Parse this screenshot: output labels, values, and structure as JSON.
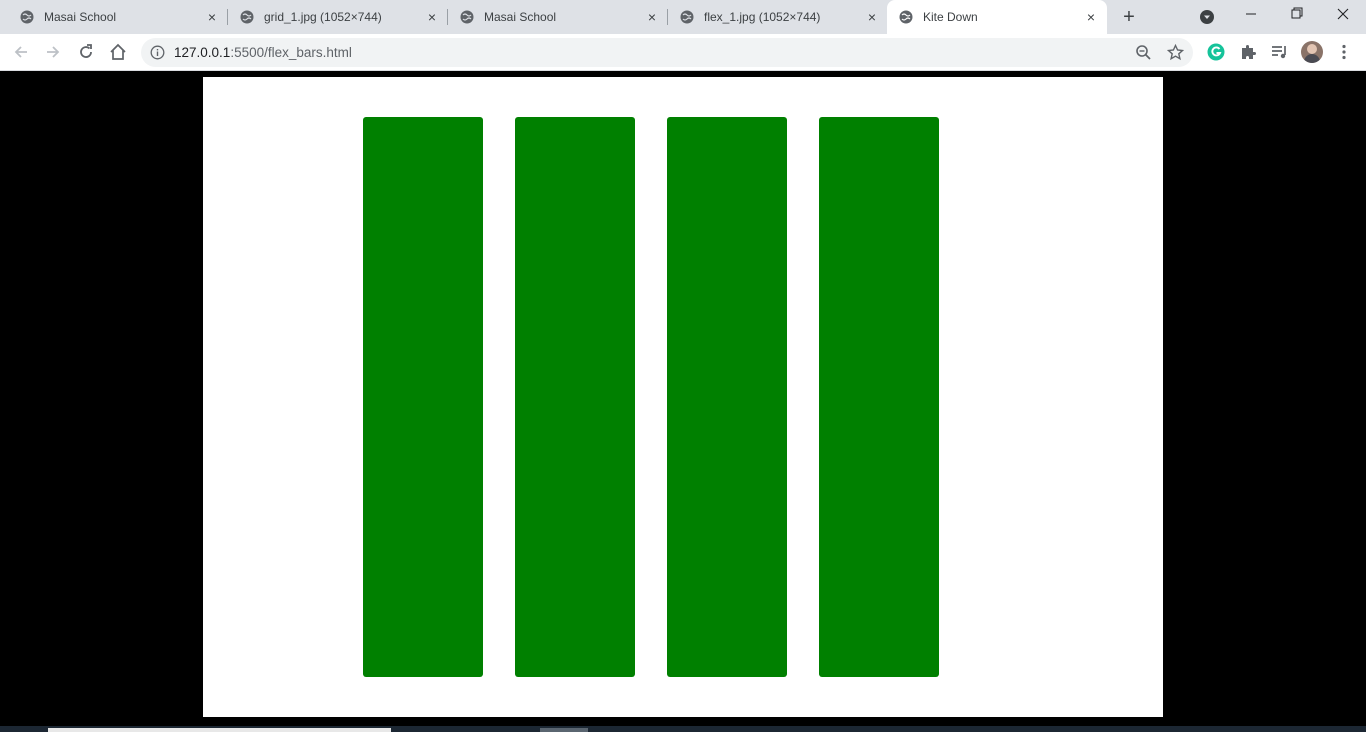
{
  "browser": {
    "tabs": [
      {
        "title": "Masai School",
        "active": false
      },
      {
        "title": "grid_1.jpg (1052×744)",
        "active": false
      },
      {
        "title": "Masai School",
        "active": false
      },
      {
        "title": "flex_1.jpg (1052×744)",
        "active": false
      },
      {
        "title": "Kite Down",
        "active": true
      }
    ],
    "new_tab_label": "+",
    "close_glyph": "×",
    "address": {
      "host": "127.0.0.1",
      "rest": ":5500/flex_bars.html"
    },
    "icons": {
      "favicon": "globe-icon",
      "back": "arrow-left-icon",
      "forward": "arrow-right-icon",
      "reload": "reload-icon",
      "home": "home-icon",
      "site_info": "info-icon",
      "zoom": "zoom-out-icon",
      "bookmark": "star-icon",
      "grammarly": "grammarly-icon",
      "extensions": "puzzle-icon",
      "media": "queue-music-icon",
      "profile": "avatar",
      "menu": "kebab-menu-icon"
    }
  },
  "page": {
    "bar_color": "#008000",
    "bar_count": 4
  },
  "colors": {
    "tabstrip": "#dee1e6",
    "toolbar": "#ffffff",
    "page_bg": "#000000",
    "content_bg": "#ffffff"
  }
}
